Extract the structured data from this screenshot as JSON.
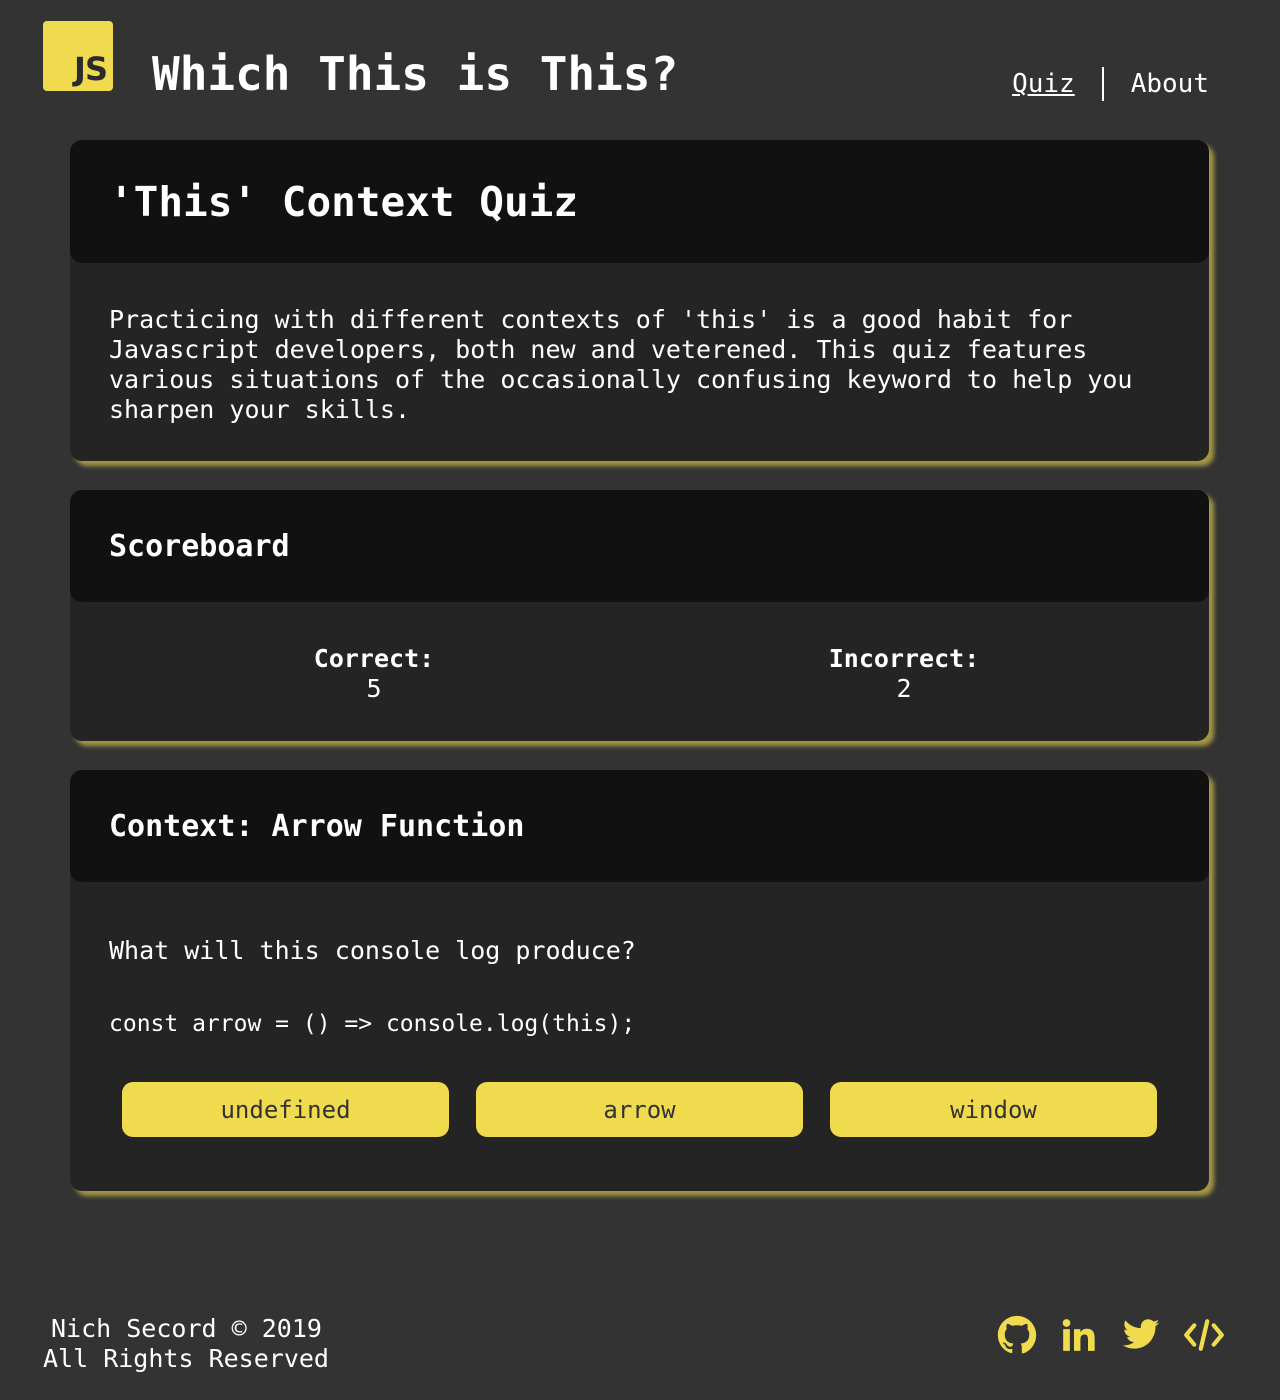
{
  "header": {
    "logo_text": "JS",
    "site_title": "Which This is This?",
    "nav": [
      {
        "label": "Quiz",
        "active": true
      },
      {
        "label": "About",
        "active": false
      }
    ]
  },
  "intro": {
    "title": "'This' Context Quiz",
    "body": "Practicing with different contexts of 'this' is a good habit for Javascript developers, both new and veterened. This quiz features various situations of the occasionally confusing keyword to help you sharpen your skills."
  },
  "scoreboard": {
    "title": "Scoreboard",
    "correct_label": "Correct:",
    "correct_value": "5",
    "incorrect_label": "Incorrect:",
    "incorrect_value": "2"
  },
  "question": {
    "title": "Context: Arrow Function",
    "prompt": "What will this console log produce?",
    "code": "const arrow = () => console.log(this);",
    "answers": [
      "undefined",
      "arrow",
      "window"
    ]
  },
  "footer": {
    "line1": "Nich Secord © 2019",
    "line2": "All Rights Reserved",
    "social_icons": [
      "github-icon",
      "linkedin-icon",
      "twitter-icon",
      "code-icon"
    ]
  },
  "colors": {
    "accent": "#f0db4f",
    "background": "#333333",
    "card_body": "#242424",
    "card_header": "#111111"
  }
}
